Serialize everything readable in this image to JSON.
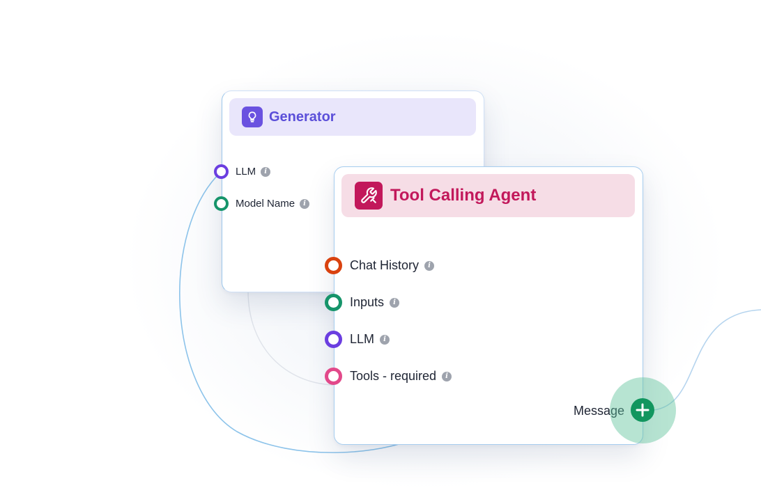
{
  "generator": {
    "title": "Generator",
    "icon": "lightbulb-icon",
    "accent": "#6a52e0",
    "ports": [
      {
        "label": "LLM",
        "color": "#6b3ee0"
      },
      {
        "label": "Model Name",
        "color": "#16946a"
      }
    ]
  },
  "agent": {
    "title": "Tool Calling Agent",
    "icon": "tools-icon",
    "accent": "#c2185b",
    "ports": [
      {
        "label": "Chat History",
        "color": "#d9420f"
      },
      {
        "label": "Inputs",
        "color": "#16946a"
      },
      {
        "label": "LLM",
        "color": "#6b3ee0"
      },
      {
        "label": "Tools - required",
        "color": "#e2498a"
      }
    ],
    "output": {
      "label": "Message",
      "color": "#12965f"
    }
  }
}
